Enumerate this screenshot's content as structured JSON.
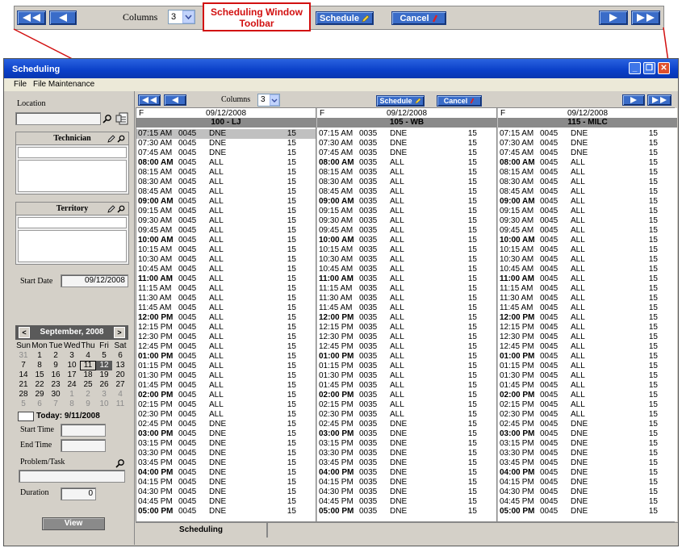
{
  "top_toolbar": {
    "columns_label": "Columns",
    "columns_value": "3",
    "schedule_label": "Schedule",
    "cancel_label": "Cancel"
  },
  "callout": {
    "line1": "Scheduling Window",
    "line2": "Toolbar"
  },
  "window": {
    "title": "Scheduling"
  },
  "menu": {
    "file": "File",
    "file_maintenance": "File Maintenance"
  },
  "left_panel": {
    "location_label": "Location",
    "technician_label": "Technician",
    "territory_label": "Territory",
    "start_date_label": "Start Date",
    "start_date_value": "09/12/2008",
    "start_time_label": "Start Time",
    "end_time_label": "End Time",
    "problem_task_label": "Problem/Task",
    "duration_label": "Duration",
    "duration_value": "0",
    "view_button": "View",
    "today_label": "Today: 9/11/2008"
  },
  "calendar": {
    "month": "September, 2008",
    "prev": "<",
    "next": ">",
    "weekdays": [
      "Sun",
      "Mon",
      "Tue",
      "Wed",
      "Thu",
      "Fri",
      "Sat"
    ],
    "weeks": [
      [
        "31",
        "1",
        "2",
        "3",
        "4",
        "5",
        "6"
      ],
      [
        "7",
        "8",
        "9",
        "10",
        "11",
        "12",
        "13"
      ],
      [
        "14",
        "15",
        "16",
        "17",
        "18",
        "19",
        "20"
      ],
      [
        "21",
        "22",
        "23",
        "24",
        "25",
        "26",
        "27"
      ],
      [
        "28",
        "29",
        "30",
        "1",
        "2",
        "3",
        "4"
      ],
      [
        "5",
        "6",
        "7",
        "8",
        "9",
        "10",
        "11"
      ]
    ]
  },
  "grid_toolbar": {
    "columns_label": "Columns",
    "columns_value": "3",
    "schedule_label": "Schedule",
    "cancel_label": "Cancel"
  },
  "columns": [
    {
      "flag": "F",
      "date": "09/12/2008",
      "resource": "100 - LJ",
      "id": "0045"
    },
    {
      "flag": "F",
      "date": "09/12/2008",
      "resource": "105 - WB",
      "id": "0035"
    },
    {
      "flag": "F",
      "date": "09/12/2008",
      "resource": "115 - MILC",
      "id": "0045"
    }
  ],
  "slots": [
    {
      "time": "07:15 AM",
      "status": "DNE",
      "num": "15"
    },
    {
      "time": "07:30 AM",
      "status": "DNE",
      "num": "15"
    },
    {
      "time": "07:45 AM",
      "status": "DNE",
      "num": "15"
    },
    {
      "time": "08:00 AM",
      "status": "ALL",
      "num": "15",
      "bold": true
    },
    {
      "time": "08:15 AM",
      "status": "ALL",
      "num": "15"
    },
    {
      "time": "08:30 AM",
      "status": "ALL",
      "num": "15"
    },
    {
      "time": "08:45 AM",
      "status": "ALL",
      "num": "15"
    },
    {
      "time": "09:00 AM",
      "status": "ALL",
      "num": "15",
      "bold": true
    },
    {
      "time": "09:15 AM",
      "status": "ALL",
      "num": "15"
    },
    {
      "time": "09:30 AM",
      "status": "ALL",
      "num": "15"
    },
    {
      "time": "09:45 AM",
      "status": "ALL",
      "num": "15"
    },
    {
      "time": "10:00 AM",
      "status": "ALL",
      "num": "15",
      "bold": true
    },
    {
      "time": "10:15 AM",
      "status": "ALL",
      "num": "15"
    },
    {
      "time": "10:30 AM",
      "status": "ALL",
      "num": "15"
    },
    {
      "time": "10:45 AM",
      "status": "ALL",
      "num": "15"
    },
    {
      "time": "11:00 AM",
      "status": "ALL",
      "num": "15",
      "bold": true
    },
    {
      "time": "11:15 AM",
      "status": "ALL",
      "num": "15"
    },
    {
      "time": "11:30 AM",
      "status": "ALL",
      "num": "15"
    },
    {
      "time": "11:45 AM",
      "status": "ALL",
      "num": "15"
    },
    {
      "time": "12:00 PM",
      "status": "ALL",
      "num": "15",
      "bold": true
    },
    {
      "time": "12:15 PM",
      "status": "ALL",
      "num": "15"
    },
    {
      "time": "12:30 PM",
      "status": "ALL",
      "num": "15"
    },
    {
      "time": "12:45 PM",
      "status": "ALL",
      "num": "15"
    },
    {
      "time": "01:00 PM",
      "status": "ALL",
      "num": "15",
      "bold": true
    },
    {
      "time": "01:15 PM",
      "status": "ALL",
      "num": "15"
    },
    {
      "time": "01:30 PM",
      "status": "ALL",
      "num": "15"
    },
    {
      "time": "01:45 PM",
      "status": "ALL",
      "num": "15"
    },
    {
      "time": "02:00 PM",
      "status": "ALL",
      "num": "15",
      "bold": true
    },
    {
      "time": "02:15 PM",
      "status": "ALL",
      "num": "15"
    },
    {
      "time": "02:30 PM",
      "status": "ALL",
      "num": "15"
    },
    {
      "time": "02:45 PM",
      "status": "DNE",
      "num": "15"
    },
    {
      "time": "03:00 PM",
      "status": "DNE",
      "num": "15",
      "bold": true
    },
    {
      "time": "03:15 PM",
      "status": "DNE",
      "num": "15"
    },
    {
      "time": "03:30 PM",
      "status": "DNE",
      "num": "15"
    },
    {
      "time": "03:45 PM",
      "status": "DNE",
      "num": "15"
    },
    {
      "time": "04:00 PM",
      "status": "DNE",
      "num": "15",
      "bold": true
    },
    {
      "time": "04:15 PM",
      "status": "DNE",
      "num": "15"
    },
    {
      "time": "04:30 PM",
      "status": "DNE",
      "num": "15"
    },
    {
      "time": "04:45 PM",
      "status": "DNE",
      "num": "15"
    },
    {
      "time": "05:00 PM",
      "status": "DNE",
      "num": "15",
      "bold": true
    }
  ],
  "status_bar": {
    "tab_label": "Scheduling"
  },
  "colors": {
    "accent": "#3a6cc8",
    "callout": "#d21010",
    "titlebar": "#0a3fc8"
  }
}
